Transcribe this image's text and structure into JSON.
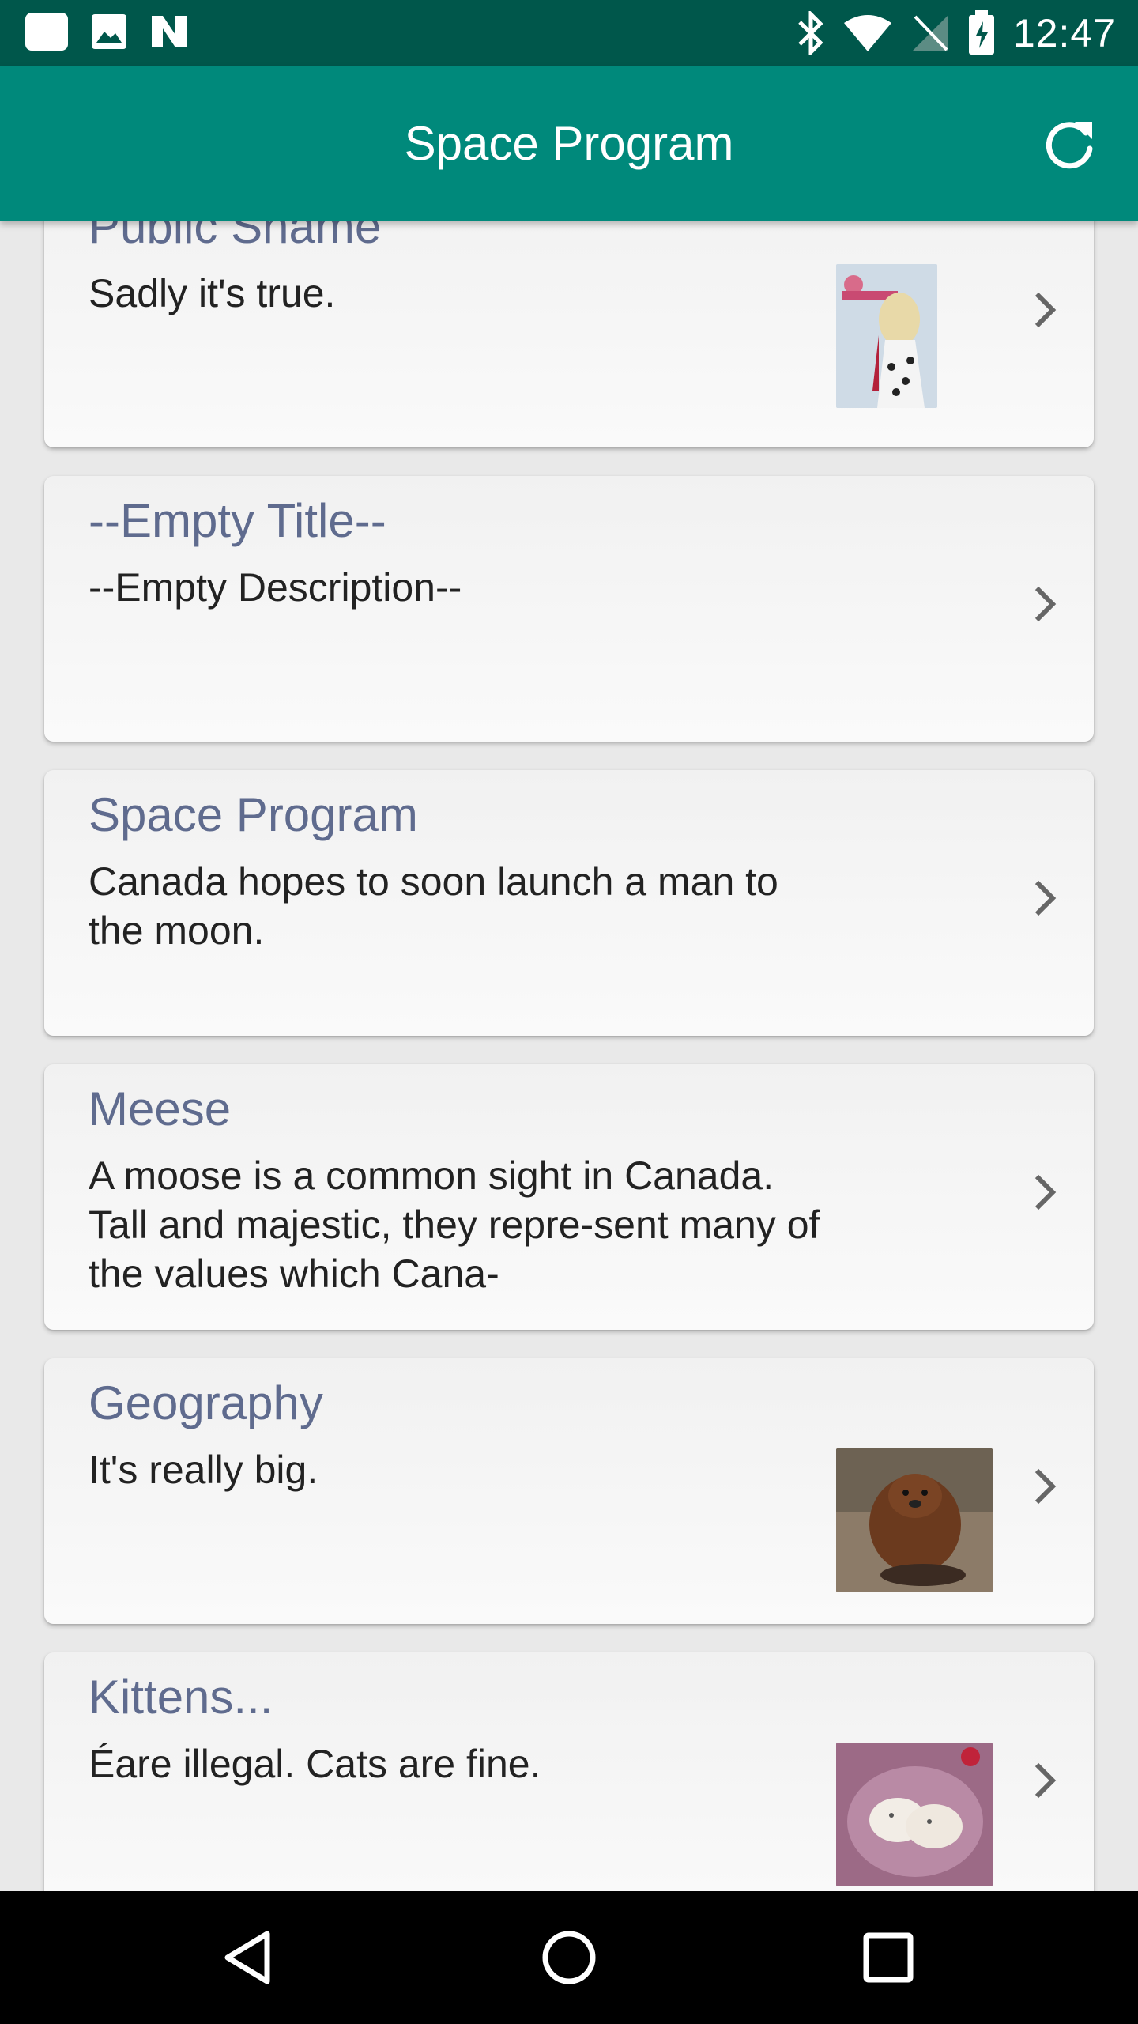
{
  "status_bar": {
    "time": "12:47",
    "left_icons": [
      "notification-icon",
      "gallery-icon",
      "n-icon"
    ],
    "right_icons": [
      "bluetooth-icon",
      "wifi-icon",
      "no-sim-icon",
      "battery-icon"
    ]
  },
  "app_bar": {
    "title": "Space Program",
    "action_icon": "refresh-icon",
    "background": "#00897b"
  },
  "cards": [
    {
      "title": "Public Shame",
      "description": " Sadly it's true.",
      "thumbnail": "album-cover-thumbnail"
    },
    {
      "title": "--Empty Title--",
      "description": "--Empty Description--",
      "thumbnail": ""
    },
    {
      "title": "Space Program",
      "description": "Canada hopes to soon launch a man to the moon.",
      "thumbnail": ""
    },
    {
      "title": "Meese",
      "description": "A moose is a common sight in Canada. Tall and majestic, they repre-sent many of the values which Cana-",
      "thumbnail": ""
    },
    {
      "title": "Geography",
      "description": "It's really big.",
      "thumbnail": "beaver-thumbnail"
    },
    {
      "title": "Kittens...",
      "description": "Éare illegal. Cats are fine.",
      "thumbnail": "kittens-thumbnail"
    }
  ],
  "nav_bar": {
    "buttons": [
      "back-icon",
      "home-icon",
      "recents-icon"
    ]
  }
}
